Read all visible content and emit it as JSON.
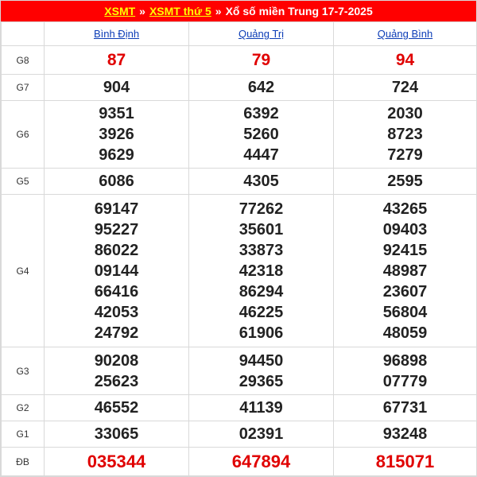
{
  "title": {
    "link1": "XSMT",
    "sep1": "»",
    "link2": "XSMT thứ 5",
    "sep2": "»",
    "text": "Xổ số miền Trung 17-7-2025"
  },
  "provinces": [
    "Bình Định",
    "Quảng Trị",
    "Quảng Bình"
  ],
  "prizes": [
    {
      "label": "G8",
      "values": [
        [
          "87"
        ],
        [
          "79"
        ],
        [
          "94"
        ]
      ],
      "style": "red"
    },
    {
      "label": "G7",
      "values": [
        [
          "904"
        ],
        [
          "642"
        ],
        [
          "724"
        ]
      ]
    },
    {
      "label": "G6",
      "values": [
        [
          "9351",
          "3926",
          "9629"
        ],
        [
          "6392",
          "5260",
          "4447"
        ],
        [
          "2030",
          "8723",
          "7279"
        ]
      ]
    },
    {
      "label": "G5",
      "values": [
        [
          "6086"
        ],
        [
          "4305"
        ],
        [
          "2595"
        ]
      ]
    },
    {
      "label": "G4",
      "values": [
        [
          "69147",
          "95227",
          "86022",
          "09144",
          "66416",
          "42053",
          "24792"
        ],
        [
          "77262",
          "35601",
          "33873",
          "42318",
          "86294",
          "46225",
          "61906"
        ],
        [
          "43265",
          "09403",
          "92415",
          "48987",
          "23607",
          "56804",
          "48059"
        ]
      ]
    },
    {
      "label": "G3",
      "values": [
        [
          "90208",
          "25623"
        ],
        [
          "94450",
          "29365"
        ],
        [
          "96898",
          "07779"
        ]
      ]
    },
    {
      "label": "G2",
      "values": [
        [
          "46552"
        ],
        [
          "41139"
        ],
        [
          "67731"
        ]
      ]
    },
    {
      "label": "G1",
      "values": [
        [
          "33065"
        ],
        [
          "02391"
        ],
        [
          "93248"
        ]
      ]
    },
    {
      "label": "ĐB",
      "values": [
        [
          "035344"
        ],
        [
          "647894"
        ],
        [
          "815071"
        ]
      ],
      "style": "red-big"
    }
  ],
  "colors": {
    "title_bg": "#ff0000",
    "title_link": "#ffff00",
    "province_link": "#0b3cb6",
    "highlight": "#e00000"
  }
}
